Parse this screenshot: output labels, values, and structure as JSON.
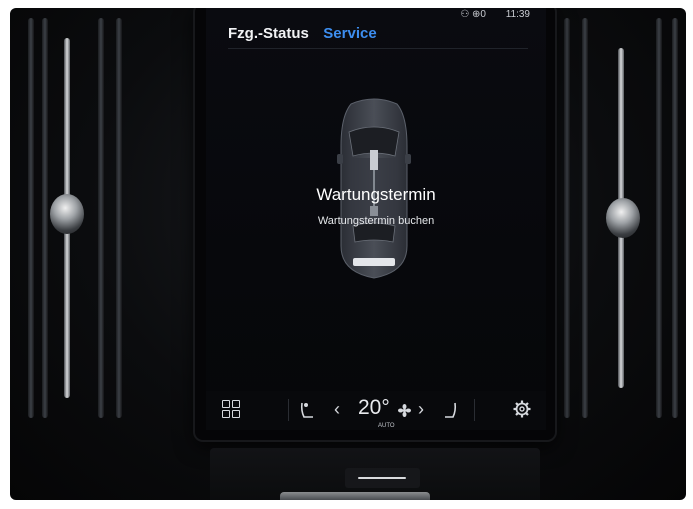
{
  "status_bar": {
    "icons": "⚇ ⊕0",
    "time": "11:39"
  },
  "tabs": [
    {
      "label": "Fzg.-Status",
      "active": false
    },
    {
      "label": "Service",
      "active": true
    }
  ],
  "main": {
    "title": "Wartungstermin",
    "subtitle": "Wartungstermin buchen"
  },
  "bottom_bar": {
    "home_icon": "grid-icon",
    "seat_left_icon": "seat-heat-driver-icon",
    "temp_down": "‹",
    "temperature": "20°",
    "fan_icon": "fan-icon",
    "temp_mode": "AUTO",
    "temp_up": "›",
    "seat_right_icon": "seat-passenger-icon",
    "settings_icon": "gear-icon"
  },
  "colors": {
    "accent": "#3d8ef0",
    "screen_bg": "#07080c",
    "text": "#f2f3f5"
  }
}
